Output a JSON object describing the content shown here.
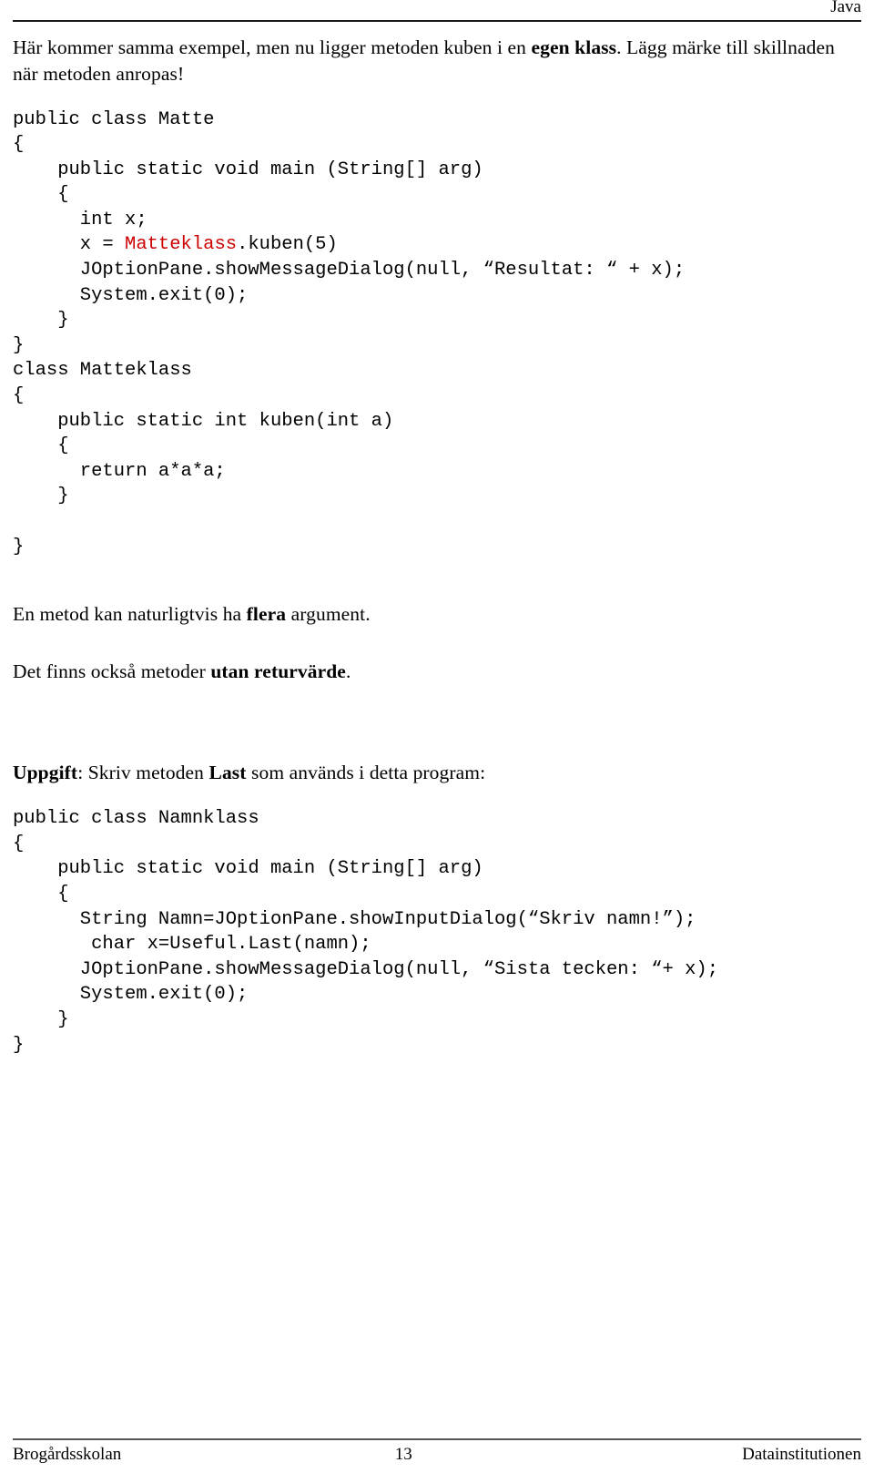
{
  "header": {
    "label": "Java"
  },
  "intro": {
    "part1": "Här kommer samma exempel, men nu ligger metoden kuben i en ",
    "bold1": "egen klass",
    "part2": ". Lägg märke till skillnaden när metoden anropas!"
  },
  "code_matte": {
    "lines": [
      "public class Matte",
      "{",
      "    public static void main (String[] arg)",
      "    {",
      "      int x;",
      "      x = ",
      "      JOptionPane.showMessageDialog(null, “Resultat: “ + x);",
      "      System.exit(0);",
      "    }",
      "}"
    ],
    "call_line_prefix": "      x = ",
    "call_line_class": "Matteklass",
    "call_line_suffix": ".kuben(5)"
  },
  "code_matteklass": {
    "lines": [
      "class Matteklass",
      "{",
      "    public static int kuben(int a)",
      "    {",
      "      return a*a*a;",
      "    }",
      "",
      "}"
    ]
  },
  "para_flera": {
    "part1": "En metod kan naturligtvis ha ",
    "bold1": "flera",
    "part2": " argument."
  },
  "para_utan": {
    "part1": "Det finns också metoder ",
    "bold1": "utan returvärde",
    "part2": "."
  },
  "para_uppgift": {
    "bold1": "Uppgift",
    "part1": ":  Skriv metoden ",
    "bold2": "Last",
    "part2": " som används i detta program:"
  },
  "code_namnklass": {
    "lines": [
      "public class Namnklass",
      "{",
      "    public static void main (String[] arg)",
      "    {",
      "      String Namn=JOptionPane.showInputDialog(“Skriv namn!”);",
      "       char x=Useful.Last(namn);",
      "      JOptionPane.showMessageDialog(null, “Sista tecken: “+ x);",
      "      System.exit(0);",
      "    }",
      "}"
    ]
  },
  "footer": {
    "left": "Brogårdsskolan",
    "page_number": "13",
    "right": "Datainstitutionen"
  },
  "colors": {
    "highlight_class": "#cc0000",
    "text": "#000000",
    "rule": "#1a1a1a",
    "footer_rule": "#555555"
  }
}
